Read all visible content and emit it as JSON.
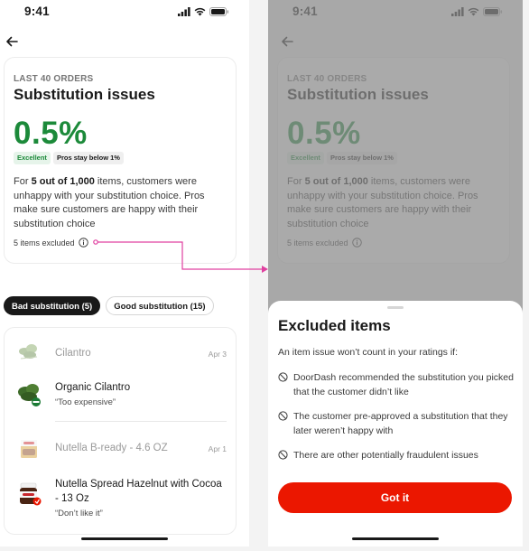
{
  "status_bar": {
    "time": "9:41"
  },
  "metric": {
    "eyebrow": "LAST 40 ORDERS",
    "title": "Substitution issues",
    "value": "0.5%",
    "badge_rating": "Excellent",
    "badge_threshold": "Pros stay below 1%",
    "desc_prefix": "For ",
    "desc_bold": "5 out of 1,000",
    "desc_suffix": " items, customers were unhappy with your substitution choice. Pros make sure customers are happy with their substitution choice",
    "excluded_label": "5 items excluded"
  },
  "filters": [
    {
      "label": "Bad substitution (5)",
      "active": true
    },
    {
      "label": "Good substitution (15)",
      "active": false
    }
  ],
  "substitutions": [
    {
      "original_name": "Cilantro",
      "date": "Apr 3",
      "substitute_name": "Organic Cilantro",
      "note": "“Too expensive”"
    },
    {
      "original_name": "Nutella B-ready - 4.6 OZ",
      "date": "Apr 1",
      "substitute_name": "Nutella Spread Hazelnut with Cocoa - 13 Oz",
      "note": "“Don’t like it”"
    }
  ],
  "sheet": {
    "title": "Excluded items",
    "intro": "An item issue won’t count in your ratings if:",
    "rules": [
      "DoorDash recommended the substitution you picked that the customer didn’t like",
      "The customer pre-approved a substitution that they later weren’t happy with",
      "There are other potentially fraudulent issues"
    ],
    "button_label": "Got it"
  },
  "colors": {
    "accent": "#eb1700",
    "success": "#1c8a3a",
    "callout_line": "#e040a0"
  },
  "icons": [
    "back-arrow-icon",
    "info-icon",
    "prohibited-icon",
    "signal-icon",
    "wifi-icon",
    "battery-icon"
  ]
}
